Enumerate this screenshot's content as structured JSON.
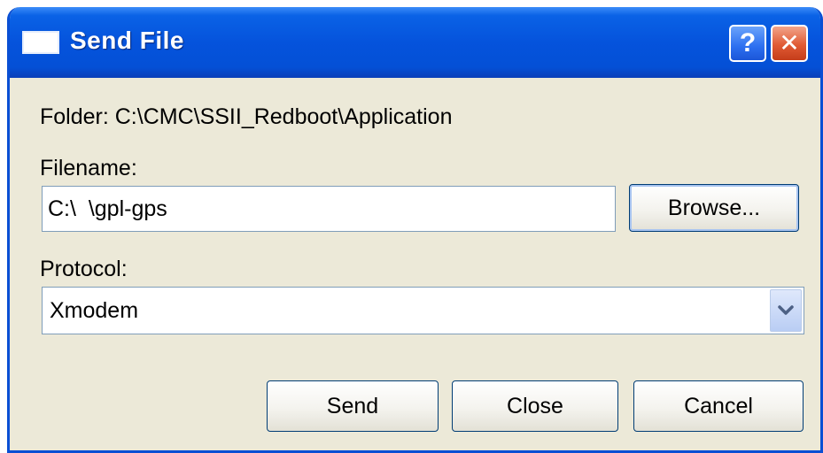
{
  "window": {
    "title": "Send File",
    "help_button": "?",
    "close_button": "✕"
  },
  "folder": {
    "label": "Folder:  C:\\CMC\\SSII_Redboot\\Application"
  },
  "filename": {
    "label": "Filename:",
    "value": "C:\\  \\gpl-gps",
    "browse_label": "Browse..."
  },
  "protocol": {
    "label": "Protocol:",
    "selected": "Xmodem",
    "dropdown_icon": "chevron-down-icon"
  },
  "actions": {
    "send_label": "Send",
    "close_label": "Close",
    "cancel_label": "Cancel"
  },
  "colors": {
    "titlebar": "#0553dc",
    "dialog_bg": "#ece9d8",
    "close_button": "#e05a34"
  }
}
